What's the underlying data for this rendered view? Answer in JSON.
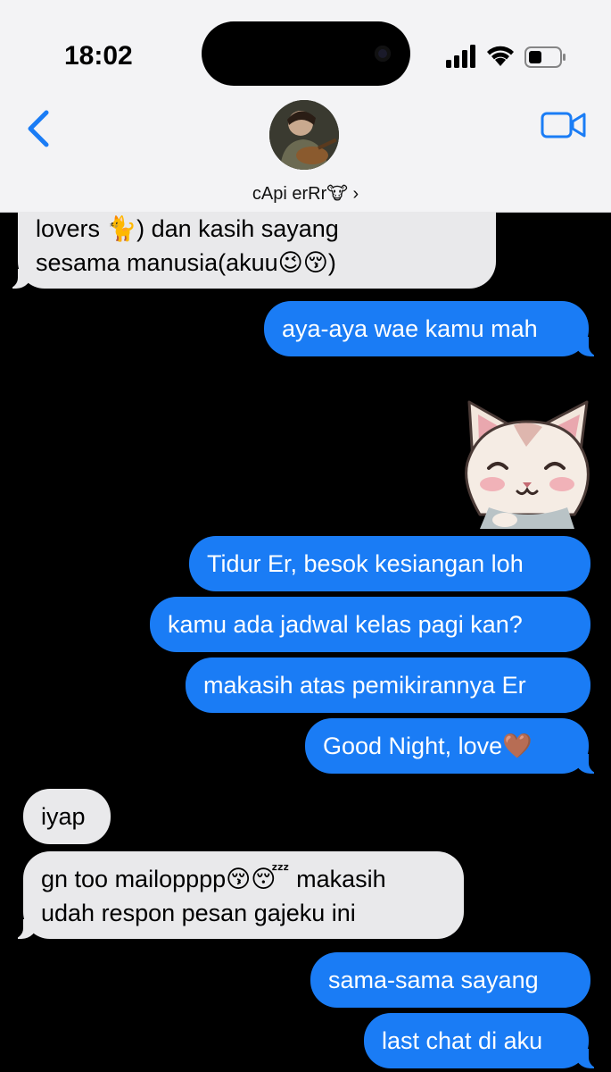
{
  "status_bar": {
    "time": "18:02"
  },
  "contact": {
    "name": "cApi erRr🐮 ›"
  },
  "messages": [
    {
      "from": "in",
      "line1": "lovers 🐈) dan kasih sayang",
      "line2": "sesama manusia(akuu😉😚)"
    },
    {
      "from": "out",
      "text": "aya-aya wae kamu mah"
    },
    {
      "from": "out",
      "type": "sticker",
      "icon": "cat-sticker"
    },
    {
      "from": "out",
      "text": "Tidur Er, besok kesiangan loh"
    },
    {
      "from": "out",
      "text": "kamu ada jadwal kelas pagi kan?"
    },
    {
      "from": "out",
      "text": "makasih atas pemikirannya Er"
    },
    {
      "from": "out",
      "text": "Good Night, love🤎"
    },
    {
      "from": "in",
      "text": "iyap"
    },
    {
      "from": "in",
      "line1": "gn too mailopppp😚😴 makasih",
      "line2": "udah respon pesan gajeku ini"
    },
    {
      "from": "out",
      "text": "sama-sama sayang"
    },
    {
      "from": "out",
      "text": "last chat di aku"
    }
  ],
  "colors": {
    "outgoing": "#1a7cf5",
    "incoming": "#e9e9eb",
    "background": "#000000",
    "accent": "#1a7cf5"
  }
}
